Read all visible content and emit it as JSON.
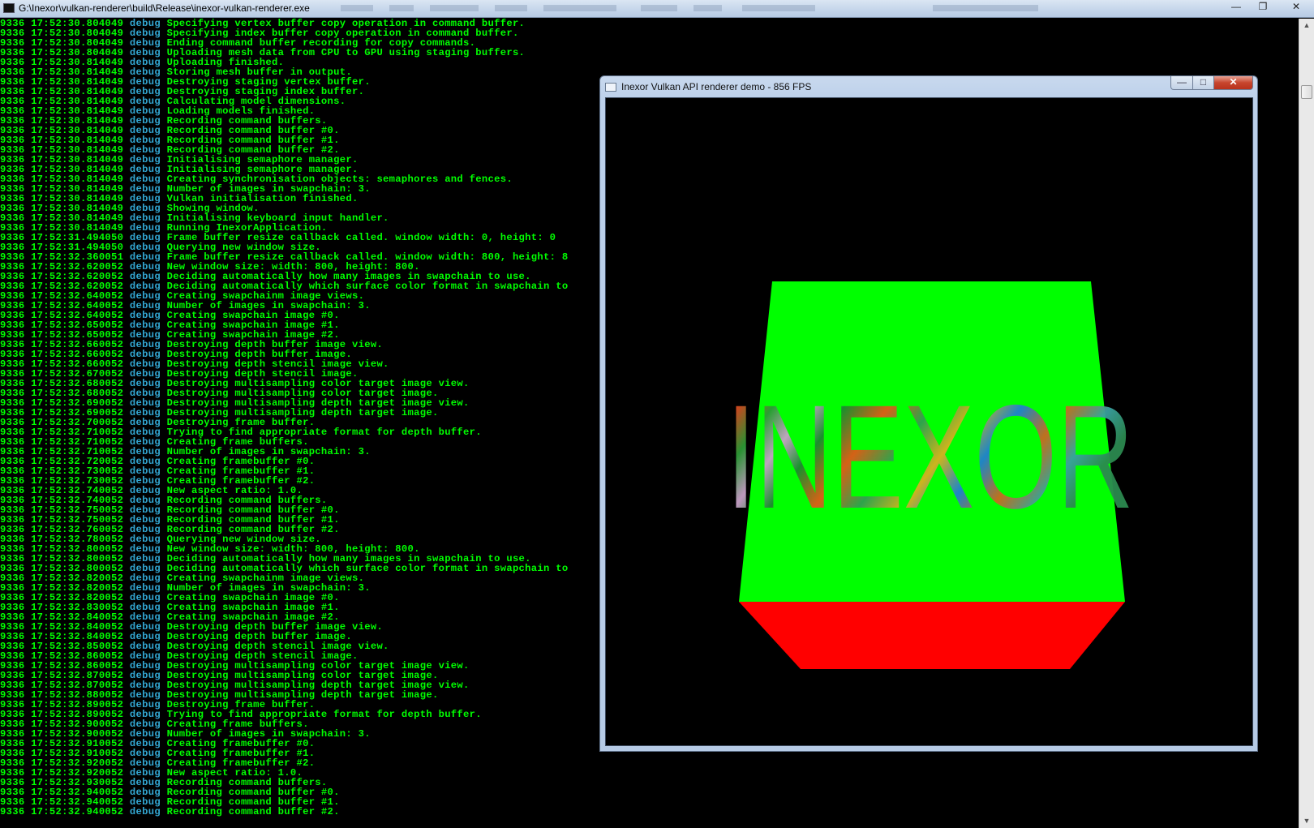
{
  "console": {
    "title": "G:\\Inexor\\vulkan-renderer\\build\\Release\\inexor-vulkan-renderer.exe",
    "lines": [
      {
        "pid": "9336",
        "time": "17:52:30.804049",
        "level": "debug",
        "msg": "Specifying vertex buffer copy operation in command buffer."
      },
      {
        "pid": "9336",
        "time": "17:52:30.804049",
        "level": "debug",
        "msg": "Specifying index buffer copy operation in command buffer."
      },
      {
        "pid": "9336",
        "time": "17:52:30.804049",
        "level": "debug",
        "msg": "Ending command buffer recording for copy commands."
      },
      {
        "pid": "9336",
        "time": "17:52:30.804049",
        "level": "debug",
        "msg": "Uploading mesh data from CPU to GPU using staging buffers."
      },
      {
        "pid": "9336",
        "time": "17:52:30.814049",
        "level": "debug",
        "msg": "Uploading finished."
      },
      {
        "pid": "9336",
        "time": "17:52:30.814049",
        "level": "debug",
        "msg": "Storing mesh buffer in output."
      },
      {
        "pid": "9336",
        "time": "17:52:30.814049",
        "level": "debug",
        "msg": "Destroying staging vertex buffer."
      },
      {
        "pid": "9336",
        "time": "17:52:30.814049",
        "level": "debug",
        "msg": "Destroying staging index buffer."
      },
      {
        "pid": "9336",
        "time": "17:52:30.814049",
        "level": "debug",
        "msg": "Calculating model dimensions."
      },
      {
        "pid": "9336",
        "time": "17:52:30.814049",
        "level": "debug",
        "msg": "Loading models finished."
      },
      {
        "pid": "9336",
        "time": "17:52:30.814049",
        "level": "debug",
        "msg": "Recording command buffers."
      },
      {
        "pid": "9336",
        "time": "17:52:30.814049",
        "level": "debug",
        "msg": "Recording command buffer #0."
      },
      {
        "pid": "9336",
        "time": "17:52:30.814049",
        "level": "debug",
        "msg": "Recording command buffer #1."
      },
      {
        "pid": "9336",
        "time": "17:52:30.814049",
        "level": "debug",
        "msg": "Recording command buffer #2."
      },
      {
        "pid": "9336",
        "time": "17:52:30.814049",
        "level": "debug",
        "msg": "Initialising semaphore manager."
      },
      {
        "pid": "9336",
        "time": "17:52:30.814049",
        "level": "debug",
        "msg": "Initialising semaphore manager."
      },
      {
        "pid": "9336",
        "time": "17:52:30.814049",
        "level": "debug",
        "msg": "Creating synchronisation objects: semaphores and fences."
      },
      {
        "pid": "9336",
        "time": "17:52:30.814049",
        "level": "debug",
        "msg": "Number of images in swapchain: 3."
      },
      {
        "pid": "9336",
        "time": "17:52:30.814049",
        "level": "debug",
        "msg": "Vulkan initialisation finished."
      },
      {
        "pid": "9336",
        "time": "17:52:30.814049",
        "level": "debug",
        "msg": "Showing window."
      },
      {
        "pid": "9336",
        "time": "17:52:30.814049",
        "level": "debug",
        "msg": "Initialising keyboard input handler."
      },
      {
        "pid": "9336",
        "time": "17:52:30.814049",
        "level": "debug",
        "msg": "Running InexorApplication."
      },
      {
        "pid": "9336",
        "time": "17:52:31.494050",
        "level": "debug",
        "msg": "Frame buffer resize callback called. window width: 0, height: 0"
      },
      {
        "pid": "9336",
        "time": "17:52:31.494050",
        "level": "debug",
        "msg": "Querying new window size."
      },
      {
        "pid": "9336",
        "time": "17:52:32.360051",
        "level": "debug",
        "msg": "Frame buffer resize callback called. window width: 800, height: 8"
      },
      {
        "pid": "9336",
        "time": "17:52:32.620052",
        "level": "debug",
        "msg": "New window size: width: 800, height: 800."
      },
      {
        "pid": "9336",
        "time": "17:52:32.620052",
        "level": "debug",
        "msg": "Deciding automatically how many images in swapchain to use."
      },
      {
        "pid": "9336",
        "time": "17:52:32.620052",
        "level": "debug",
        "msg": "Deciding automatically which surface color format in swapchain to"
      },
      {
        "pid": "9336",
        "time": "17:52:32.640052",
        "level": "debug",
        "msg": "Creating swapchainm image views."
      },
      {
        "pid": "9336",
        "time": "17:52:32.640052",
        "level": "debug",
        "msg": "Number of images in swapchain: 3."
      },
      {
        "pid": "9336",
        "time": "17:52:32.640052",
        "level": "debug",
        "msg": "Creating swapchain image #0."
      },
      {
        "pid": "9336",
        "time": "17:52:32.650052",
        "level": "debug",
        "msg": "Creating swapchain image #1."
      },
      {
        "pid": "9336",
        "time": "17:52:32.650052",
        "level": "debug",
        "msg": "Creating swapchain image #2."
      },
      {
        "pid": "9336",
        "time": "17:52:32.660052",
        "level": "debug",
        "msg": "Destroying depth buffer image view."
      },
      {
        "pid": "9336",
        "time": "17:52:32.660052",
        "level": "debug",
        "msg": "Destroying depth buffer image."
      },
      {
        "pid": "9336",
        "time": "17:52:32.660052",
        "level": "debug",
        "msg": "Destroying depth stencil image view."
      },
      {
        "pid": "9336",
        "time": "17:52:32.670052",
        "level": "debug",
        "msg": "Destroying depth stencil image."
      },
      {
        "pid": "9336",
        "time": "17:52:32.680052",
        "level": "debug",
        "msg": "Destroying multisampling color target image view."
      },
      {
        "pid": "9336",
        "time": "17:52:32.680052",
        "level": "debug",
        "msg": "Destroying multisampling color target image."
      },
      {
        "pid": "9336",
        "time": "17:52:32.690052",
        "level": "debug",
        "msg": "Destroying multisampling depth target image view."
      },
      {
        "pid": "9336",
        "time": "17:52:32.690052",
        "level": "debug",
        "msg": "Destroying multisampling depth target image."
      },
      {
        "pid": "9336",
        "time": "17:52:32.700052",
        "level": "debug",
        "msg": "Destroying frame buffer."
      },
      {
        "pid": "9336",
        "time": "17:52:32.710052",
        "level": "debug",
        "msg": "Trying to find appropriate format for depth buffer."
      },
      {
        "pid": "9336",
        "time": "17:52:32.710052",
        "level": "debug",
        "msg": "Creating frame buffers."
      },
      {
        "pid": "9336",
        "time": "17:52:32.710052",
        "level": "debug",
        "msg": "Number of images in swapchain: 3."
      },
      {
        "pid": "9336",
        "time": "17:52:32.720052",
        "level": "debug",
        "msg": "Creating framebuffer #0."
      },
      {
        "pid": "9336",
        "time": "17:52:32.730052",
        "level": "debug",
        "msg": "Creating framebuffer #1."
      },
      {
        "pid": "9336",
        "time": "17:52:32.730052",
        "level": "debug",
        "msg": "Creating framebuffer #2."
      },
      {
        "pid": "9336",
        "time": "17:52:32.740052",
        "level": "debug",
        "msg": "New aspect ratio: 1.0."
      },
      {
        "pid": "9336",
        "time": "17:52:32.740052",
        "level": "debug",
        "msg": "Recording command buffers."
      },
      {
        "pid": "9336",
        "time": "17:52:32.750052",
        "level": "debug",
        "msg": "Recording command buffer #0."
      },
      {
        "pid": "9336",
        "time": "17:52:32.750052",
        "level": "debug",
        "msg": "Recording command buffer #1."
      },
      {
        "pid": "9336",
        "time": "17:52:32.760052",
        "level": "debug",
        "msg": "Recording command buffer #2."
      },
      {
        "pid": "9336",
        "time": "17:52:32.780052",
        "level": "debug",
        "msg": "Querying new window size."
      },
      {
        "pid": "9336",
        "time": "17:52:32.800052",
        "level": "debug",
        "msg": "New window size: width: 800, height: 800."
      },
      {
        "pid": "9336",
        "time": "17:52:32.800052",
        "level": "debug",
        "msg": "Deciding automatically how many images in swapchain to use."
      },
      {
        "pid": "9336",
        "time": "17:52:32.800052",
        "level": "debug",
        "msg": "Deciding automatically which surface color format in swapchain to"
      },
      {
        "pid": "9336",
        "time": "17:52:32.820052",
        "level": "debug",
        "msg": "Creating swapchainm image views."
      },
      {
        "pid": "9336",
        "time": "17:52:32.820052",
        "level": "debug",
        "msg": "Number of images in swapchain: 3."
      },
      {
        "pid": "9336",
        "time": "17:52:32.820052",
        "level": "debug",
        "msg": "Creating swapchain image #0."
      },
      {
        "pid": "9336",
        "time": "17:52:32.830052",
        "level": "debug",
        "msg": "Creating swapchain image #1."
      },
      {
        "pid": "9336",
        "time": "17:52:32.840052",
        "level": "debug",
        "msg": "Creating swapchain image #2."
      },
      {
        "pid": "9336",
        "time": "17:52:32.840052",
        "level": "debug",
        "msg": "Destroying depth buffer image view."
      },
      {
        "pid": "9336",
        "time": "17:52:32.840052",
        "level": "debug",
        "msg": "Destroying depth buffer image."
      },
      {
        "pid": "9336",
        "time": "17:52:32.850052",
        "level": "debug",
        "msg": "Destroying depth stencil image view."
      },
      {
        "pid": "9336",
        "time": "17:52:32.860052",
        "level": "debug",
        "msg": "Destroying depth stencil image."
      },
      {
        "pid": "9336",
        "time": "17:52:32.860052",
        "level": "debug",
        "msg": "Destroying multisampling color target image view."
      },
      {
        "pid": "9336",
        "time": "17:52:32.870052",
        "level": "debug",
        "msg": "Destroying multisampling color target image."
      },
      {
        "pid": "9336",
        "time": "17:52:32.870052",
        "level": "debug",
        "msg": "Destroying multisampling depth target image view."
      },
      {
        "pid": "9336",
        "time": "17:52:32.880052",
        "level": "debug",
        "msg": "Destroying multisampling depth target image."
      },
      {
        "pid": "9336",
        "time": "17:52:32.890052",
        "level": "debug",
        "msg": "Destroying frame buffer."
      },
      {
        "pid": "9336",
        "time": "17:52:32.890052",
        "level": "debug",
        "msg": "Trying to find appropriate format for depth buffer."
      },
      {
        "pid": "9336",
        "time": "17:52:32.900052",
        "level": "debug",
        "msg": "Creating frame buffers."
      },
      {
        "pid": "9336",
        "time": "17:52:32.900052",
        "level": "debug",
        "msg": "Number of images in swapchain: 3."
      },
      {
        "pid": "9336",
        "time": "17:52:32.910052",
        "level": "debug",
        "msg": "Creating framebuffer #0."
      },
      {
        "pid": "9336",
        "time": "17:52:32.910052",
        "level": "debug",
        "msg": "Creating framebuffer #1."
      },
      {
        "pid": "9336",
        "time": "17:52:32.920052",
        "level": "debug",
        "msg": "Creating framebuffer #2."
      },
      {
        "pid": "9336",
        "time": "17:52:32.920052",
        "level": "debug",
        "msg": "New aspect ratio: 1.0."
      },
      {
        "pid": "9336",
        "time": "17:52:32.930052",
        "level": "debug",
        "msg": "Recording command buffers."
      },
      {
        "pid": "9336",
        "time": "17:52:32.940052",
        "level": "debug",
        "msg": "Recording command buffer #0."
      },
      {
        "pid": "9336",
        "time": "17:52:32.940052",
        "level": "debug",
        "msg": "Recording command buffer #1."
      },
      {
        "pid": "9336",
        "time": "17:52:32.940052",
        "level": "debug",
        "msg": "Recording command buffer #2."
      }
    ]
  },
  "renderer_window": {
    "title": "Inexor Vulkan API renderer demo - 856 FPS",
    "minimize_label": "—",
    "maximize_label": "□",
    "close_label": "✕",
    "logo_text": "INEXOR"
  },
  "colors": {
    "console_text": "#00ff00",
    "log_level": "#33a7d2",
    "cube_front": "#00ff00",
    "cube_bottom": "#ff0000"
  },
  "icons": {
    "console_window": "console-window-icon",
    "renderer_window": "app-window-icon",
    "minimize": "minimize-icon",
    "maximize": "maximize-icon",
    "close": "close-icon",
    "scroll_up": "scroll-up-arrow-icon",
    "scroll_down": "scroll-down-arrow-icon"
  },
  "console_caption": {
    "minimize_label": "—",
    "maximize_label": "❐",
    "close_label": "✕"
  }
}
